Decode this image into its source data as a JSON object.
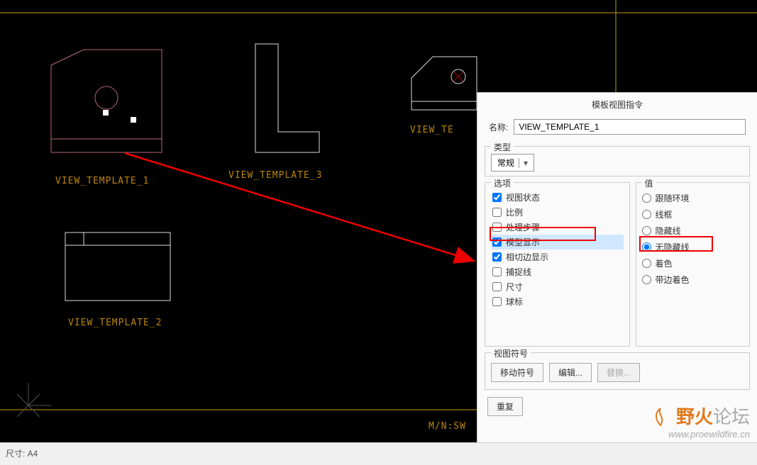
{
  "labels": {
    "v1": "VIEW_TEMPLATE_1",
    "v2": "VIEW_TEMPLATE_2",
    "v3": "VIEW_TEMPLATE_3",
    "vte": "VIEW_TE",
    "mn": "M/N:SW"
  },
  "status": {
    "dims": "尺寸: A4"
  },
  "dialog": {
    "title": "模板视图指令",
    "name_label": "名称:",
    "name_value": "VIEW_TEMPLATE_1",
    "type_label": "类型",
    "type_value": "常规",
    "options_label": "选项",
    "value_label": "值",
    "symbol_label": "视图符号",
    "options": [
      {
        "label": "视图状态",
        "checked": true
      },
      {
        "label": "比例",
        "checked": false
      },
      {
        "label": "处理步骤",
        "checked": false
      },
      {
        "label": "模型显示",
        "checked": true,
        "selected": true
      },
      {
        "label": "相切边显示",
        "checked": true
      },
      {
        "label": "捕捉线",
        "checked": false
      },
      {
        "label": "尺寸",
        "checked": false
      },
      {
        "label": "球标",
        "checked": false
      }
    ],
    "radios": [
      {
        "label": "跟随环境",
        "checked": false
      },
      {
        "label": "线框",
        "checked": false
      },
      {
        "label": "隐藏线",
        "checked": false
      },
      {
        "label": "无隐藏线",
        "checked": true
      },
      {
        "label": "着色",
        "checked": false
      },
      {
        "label": "带边着色",
        "checked": false
      }
    ],
    "buttons": {
      "move_symbol": "移动符号",
      "edit": "编辑...",
      "replace": "替换...",
      "repeat": "重复"
    }
  },
  "watermark": {
    "line1a": "野火",
    "line1b": "论坛",
    "line2": "www.proewildfire.cn"
  }
}
